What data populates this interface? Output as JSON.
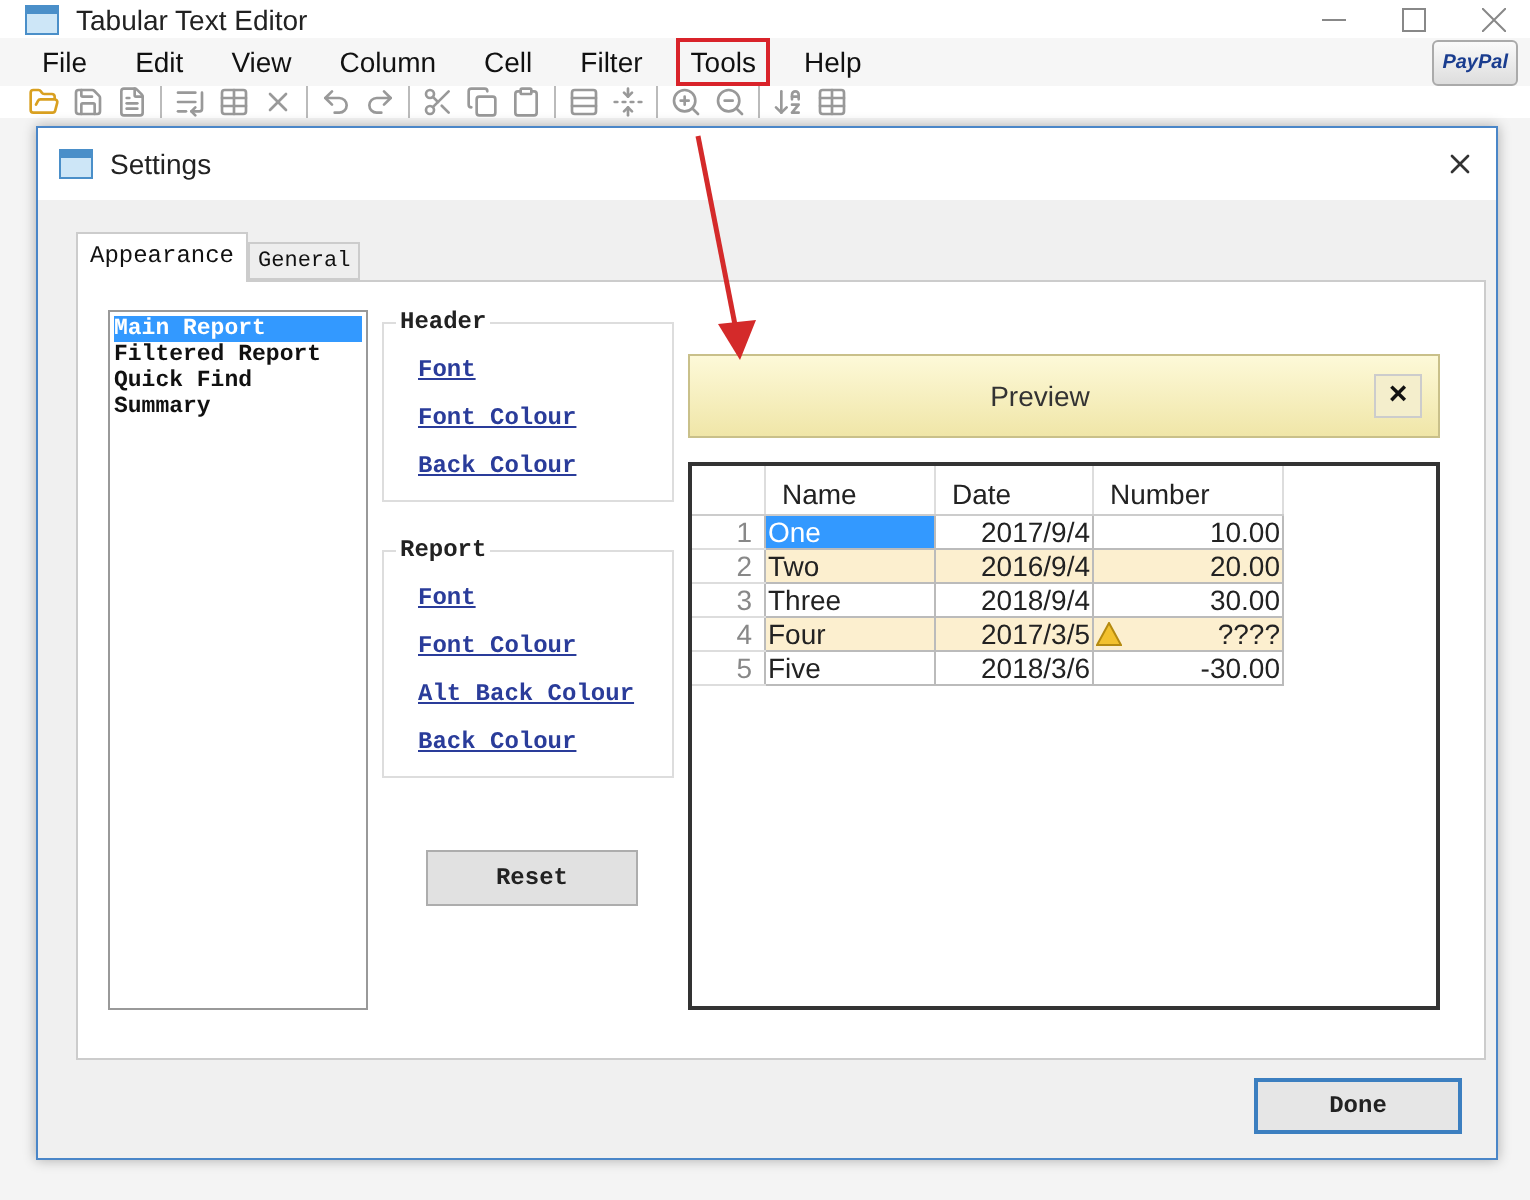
{
  "window": {
    "title": "Tabular Text Editor"
  },
  "menu": [
    {
      "label": "File",
      "highlighted": false
    },
    {
      "label": "Edit",
      "highlighted": false
    },
    {
      "label": "View",
      "highlighted": false
    },
    {
      "label": "Column",
      "highlighted": false
    },
    {
      "label": "Cell",
      "highlighted": false
    },
    {
      "label": "Filter",
      "highlighted": false
    },
    {
      "label": "Tools",
      "highlighted": true
    },
    {
      "label": "Help",
      "highlighted": false
    }
  ],
  "paypal": "PayPal",
  "dialog": {
    "title": "Settings",
    "tabs": [
      {
        "label": "Appearance",
        "selected": true
      },
      {
        "label": "General",
        "selected": false
      }
    ],
    "report_list": [
      {
        "label": "Main Report",
        "selected": true
      },
      {
        "label": "Filtered Report",
        "selected": false
      },
      {
        "label": "Quick Find",
        "selected": false
      },
      {
        "label": "Summary",
        "selected": false
      }
    ],
    "groups": [
      {
        "title": "Header",
        "links": [
          "Font",
          "Font Colour",
          "Back Colour"
        ]
      },
      {
        "title": "Report",
        "links": [
          "Font",
          "Font Colour",
          "Alt Back Colour",
          "Back Colour"
        ]
      }
    ],
    "reset": "Reset",
    "preview": {
      "title": "Preview",
      "close": "×",
      "columns": [
        "Name",
        "Date",
        "Number"
      ],
      "rows": [
        {
          "index": "1",
          "cells": [
            "One",
            "2017/9/4",
            "10.00"
          ],
          "alt": false,
          "selected": true,
          "warning": false
        },
        {
          "index": "2",
          "cells": [
            "Two",
            "2016/9/4",
            "20.00"
          ],
          "alt": true,
          "selected": false,
          "warning": false
        },
        {
          "index": "3",
          "cells": [
            "Three",
            "2018/9/4",
            "30.00"
          ],
          "alt": false,
          "selected": false,
          "warning": false
        },
        {
          "index": "4",
          "cells": [
            "Four",
            "2017/3/5",
            "????"
          ],
          "alt": true,
          "selected": false,
          "warning": true
        },
        {
          "index": "5",
          "cells": [
            "Five",
            "2018/3/6",
            "-30.00"
          ],
          "alt": false,
          "selected": false,
          "warning": false
        }
      ]
    },
    "done": "Done"
  }
}
